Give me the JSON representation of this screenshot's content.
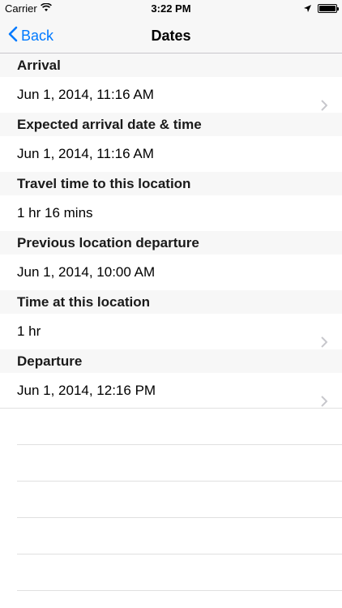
{
  "status_bar": {
    "carrier": "Carrier",
    "time": "3:22 PM"
  },
  "nav": {
    "back_label": "Back",
    "title": "Dates"
  },
  "sections": [
    {
      "header": "Arrival",
      "value": "Jun 1, 2014, 11:16 AM",
      "disclosure": true
    },
    {
      "header": "Expected arrival date & time",
      "value": "Jun 1, 2014, 11:16 AM",
      "disclosure": false
    },
    {
      "header": "Travel time to this location",
      "value": "1 hr 16 mins",
      "disclosure": false
    },
    {
      "header": "Previous location departure",
      "value": "Jun 1, 2014, 10:00 AM",
      "disclosure": false
    },
    {
      "header": "Time at this location",
      "value": "1 hr",
      "disclosure": true
    },
    {
      "header": "Departure",
      "value": "Jun 1, 2014, 12:16 PM",
      "disclosure": true
    }
  ],
  "colors": {
    "accent": "#007aff",
    "header_bg": "#f7f7f7",
    "chevron": "#c7c7cc"
  }
}
